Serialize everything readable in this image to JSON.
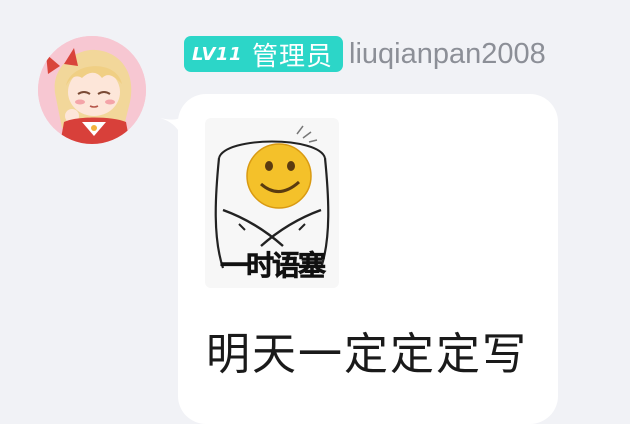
{
  "colors": {
    "background": "#f1f2f6",
    "bubble": "#ffffff",
    "badge": "#2cd6c8",
    "username": "#8c8f97",
    "message_text": "#1a1a1a"
  },
  "user": {
    "avatar_icon": "anime-girl-avatar",
    "level": "LV11",
    "role": "管理员",
    "username": "liuqianpan2008"
  },
  "message": {
    "sticker": {
      "icon": "awkward-smiley-meme-sticker",
      "caption": "一时语塞"
    },
    "text": "明天一定定定写"
  }
}
